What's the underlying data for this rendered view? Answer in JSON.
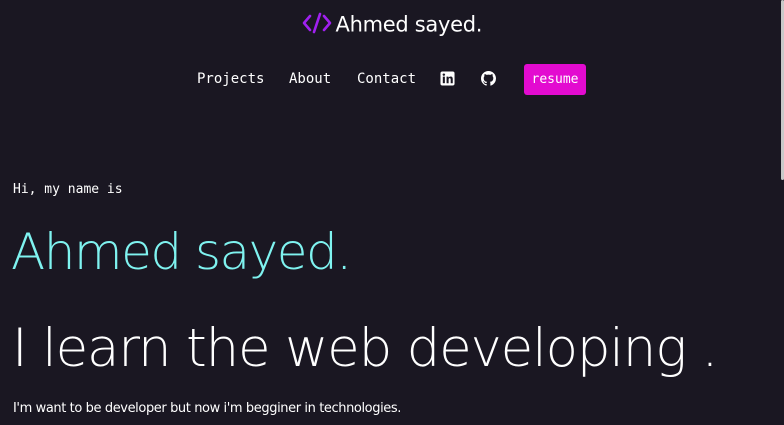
{
  "header": {
    "logo_text": "Ahmed sayed",
    "logo_dot": ".",
    "logo_icon": "code-brackets-icon",
    "logo_icon_color": "#a020f0"
  },
  "nav": {
    "items": [
      {
        "label": "Projects"
      },
      {
        "label": "About"
      },
      {
        "label": "Contact"
      }
    ],
    "icons": [
      "linkedin-icon",
      "github-icon"
    ],
    "resume_label": "resume",
    "resume_color": "#e30bd0"
  },
  "hero": {
    "greeting": "Hi, my name is",
    "name": "Ahmed sayed.",
    "name_color": "#7ff3f0",
    "tagline": "I learn the web developing .",
    "description": "I'm want to be developer but now i'm begginer in technologies."
  },
  "colors": {
    "background": "#1a1722",
    "text": "#ffffff"
  }
}
